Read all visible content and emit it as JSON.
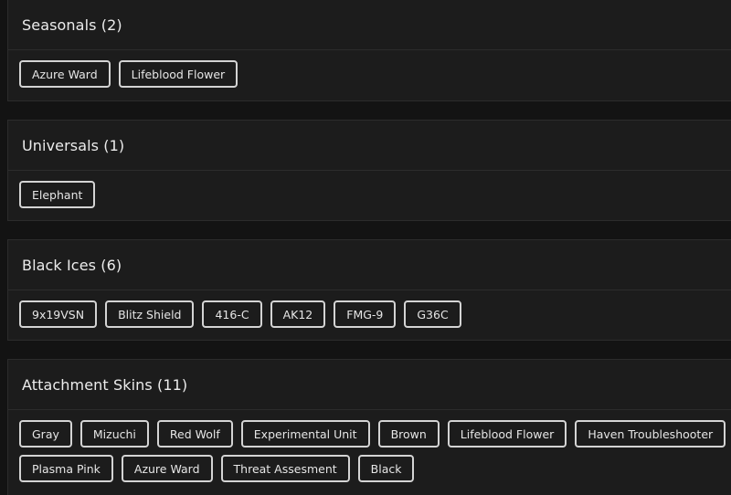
{
  "sections": [
    {
      "title": "Seasonals (2)",
      "items": [
        "Azure Ward",
        "Lifeblood Flower"
      ]
    },
    {
      "title": "Universals (1)",
      "items": [
        "Elephant"
      ]
    },
    {
      "title": "Black Ices (6)",
      "items": [
        "9x19VSN",
        "Blitz Shield",
        "416-C",
        "AK12",
        "FMG-9",
        "G36C"
      ]
    },
    {
      "title": "Attachment Skins (11)",
      "items": [
        "Gray",
        "Mizuchi",
        "Red Wolf",
        "Experimental Unit",
        "Brown",
        "Lifeblood Flower",
        "Haven Troubleshooter",
        "Plasma Pink",
        "Azure Ward",
        "Threat Assesment",
        "Black"
      ]
    }
  ]
}
